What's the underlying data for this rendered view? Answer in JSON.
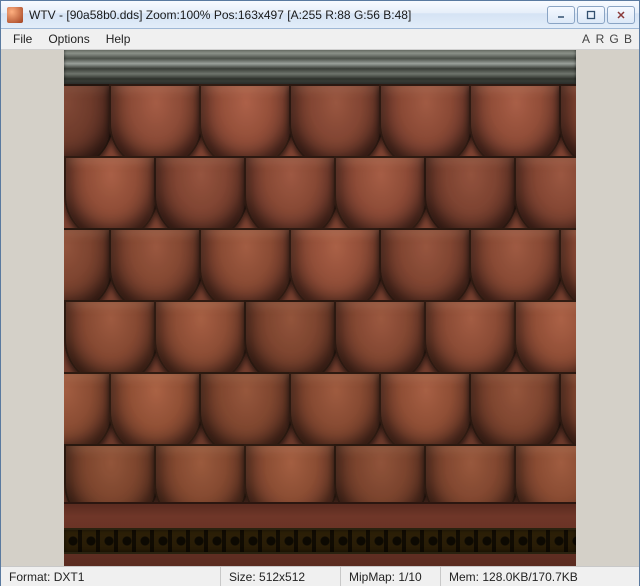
{
  "titlebar": {
    "app": "WTV",
    "file": "[90a58b0.dds]",
    "zoom": "Zoom:100%",
    "pos": "Pos:163x497",
    "pixel": "[A:255 R:88 G:56 B:48]"
  },
  "menu": {
    "file": "File",
    "options": "Options",
    "help": "Help"
  },
  "channels": {
    "a": "A",
    "r": "R",
    "g": "G",
    "b": "B"
  },
  "status": {
    "format_label": "Format:",
    "format_value": "DXT1",
    "size_label": "Size:",
    "size_value": "512x512",
    "mip_label": "MipMap:",
    "mip_value": "1/10",
    "mem_label": "Mem:",
    "mem_value": "128.0KB/170.7KB"
  }
}
